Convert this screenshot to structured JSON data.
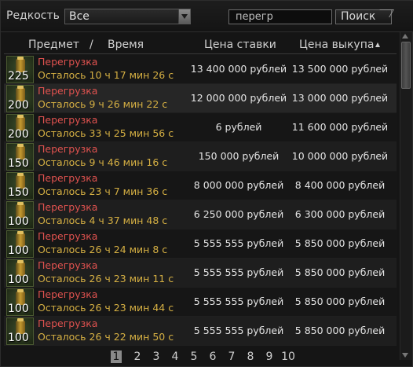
{
  "filters": {
    "rarity_label": "Редкость",
    "rarity_value": "Все",
    "search_value": "перегр",
    "search_button": "Поиск"
  },
  "columns": {
    "item": "Предмет",
    "separator": "/",
    "time": "Время",
    "bid": "Цена ставки",
    "buyout": "Цена выкупа"
  },
  "rows": [
    {
      "count": "225",
      "name": "Перегрузка",
      "time": "Осталось 10 ч 17 мин 26 с",
      "bid": "13 400 000 рублей",
      "buyout": "13 500 000 рублей"
    },
    {
      "count": "200",
      "name": "Перегрузка",
      "time": "Осталось 9 ч 26 мин 22 с",
      "bid": "12 000 000 рублей",
      "buyout": "13 000 000 рублей"
    },
    {
      "count": "200",
      "name": "Перегрузка",
      "time": "Осталось 33 ч 25 мин 56 с",
      "bid": "6 рублей",
      "buyout": "11 600 000 рублей"
    },
    {
      "count": "150",
      "name": "Перегрузка",
      "time": "Осталось 9 ч 46 мин 16 с",
      "bid": "150 000 рублей",
      "buyout": "10 000 000 рублей"
    },
    {
      "count": "150",
      "name": "Перегрузка",
      "time": "Осталось 23 ч 7 мин 36 с",
      "bid": "8 000 000 рублей",
      "buyout": "8 400 000 рублей"
    },
    {
      "count": "100",
      "name": "Перегрузка",
      "time": "Осталось 4 ч 37 мин 48 с",
      "bid": "6 250 000 рублей",
      "buyout": "6 300 000 рублей"
    },
    {
      "count": "100",
      "name": "Перегрузка",
      "time": "Осталось 26 ч 24 мин 8 с",
      "bid": "5 555 555 рублей",
      "buyout": "5 850 000 рублей"
    },
    {
      "count": "100",
      "name": "Перегрузка",
      "time": "Осталось 26 ч 23 мин 11 с",
      "bid": "5 555 555 рублей",
      "buyout": "5 850 000 рублей"
    },
    {
      "count": "100",
      "name": "Перегрузка",
      "time": "Осталось 26 ч 23 мин 44 с",
      "bid": "5 555 555 рублей",
      "buyout": "5 850 000 рублей"
    },
    {
      "count": "100",
      "name": "Перегрузка",
      "time": "Осталось 26 ч 22 мин 50 с",
      "bid": "5 555 555 рублей",
      "buyout": "5 850 000 рублей"
    }
  ],
  "pagination": {
    "current": "1",
    "pages": [
      "2",
      "3",
      "4",
      "5",
      "6",
      "7",
      "8",
      "9",
      "10"
    ]
  },
  "icons": {
    "item": "overload-jar-icon",
    "sort": "sort-ascending-icon",
    "dropdown": "dropdown-arrow-icon"
  }
}
